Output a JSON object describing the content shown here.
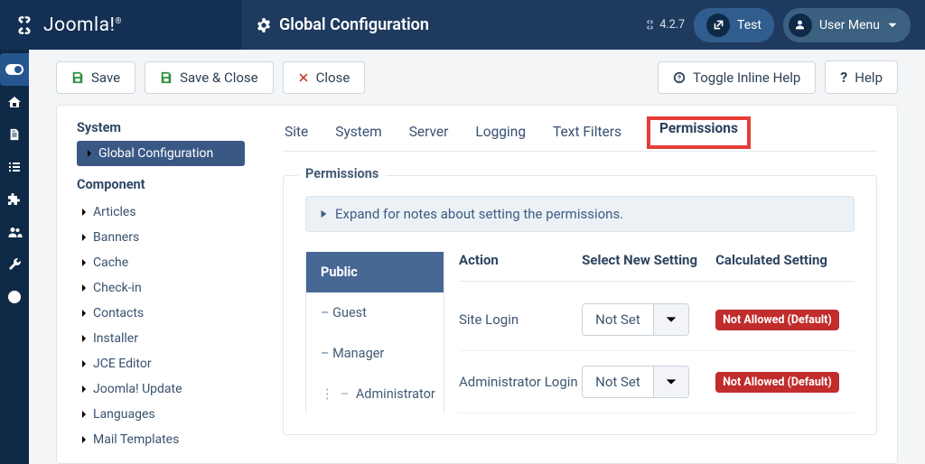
{
  "brand": "Joomla!",
  "page_title": "Global Configuration",
  "version": "4.2.7",
  "header_buttons": {
    "test": "Test",
    "user_menu": "User Menu"
  },
  "toolbar": {
    "save": "Save",
    "save_close": "Save & Close",
    "close": "Close",
    "toggle_help": "Toggle Inline Help",
    "help": "Help"
  },
  "config_nav": {
    "system_heading": "System",
    "system_active": "Global Configuration",
    "component_heading": "Component",
    "components": [
      "Articles",
      "Banners",
      "Cache",
      "Check-in",
      "Contacts",
      "Installer",
      "JCE Editor",
      "Joomla! Update",
      "Languages",
      "Mail Templates"
    ]
  },
  "tabs": [
    "Site",
    "System",
    "Server",
    "Logging",
    "Text Filters",
    "Permissions"
  ],
  "permissions": {
    "legend": "Permissions",
    "expand_note": "Expand for notes about setting the permissions.",
    "groups": [
      {
        "label": "Public",
        "indent": 0,
        "active": true
      },
      {
        "label": "Guest",
        "indent": 1,
        "active": false
      },
      {
        "label": "Manager",
        "indent": 1,
        "active": false
      },
      {
        "label": "Administrator",
        "indent": 2,
        "active": false
      }
    ],
    "headers": {
      "action": "Action",
      "select": "Select New Setting",
      "calc": "Calculated Setting"
    },
    "rows": [
      {
        "action": "Site Login",
        "select": "Not Set",
        "calc": "Not Allowed (Default)"
      },
      {
        "action": "Administrator Login",
        "select": "Not Set",
        "calc": "Not Allowed (Default)"
      }
    ]
  }
}
